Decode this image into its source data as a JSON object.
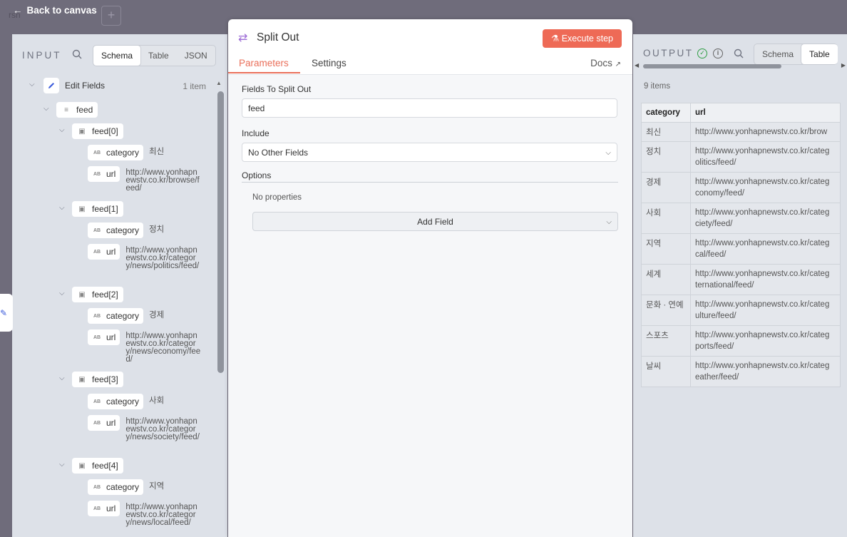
{
  "topbar": {
    "back_label": "Back to canvas",
    "node_ghost": "rsn",
    "plus": "+"
  },
  "input": {
    "title": "INPUT",
    "tabs": [
      "Schema",
      "Table",
      "JSON"
    ],
    "active_tab": "Schema",
    "root": {
      "label": "Edit Fields",
      "count": "1 item"
    },
    "feed_label": "feed",
    "items": [
      {
        "label": "feed[0]",
        "category": "최신",
        "url": "http://www.yonhapnewstv.co.kr/browse/feed/"
      },
      {
        "label": "feed[1]",
        "category": "정치",
        "url": "http://www.yonhapnewstv.co.kr/category/news/politics/feed/"
      },
      {
        "label": "feed[2]",
        "category": "경제",
        "url": "http://www.yonhapnewstv.co.kr/category/news/economy/feed/"
      },
      {
        "label": "feed[3]",
        "category": "사회",
        "url": "http://www.yonhapnewstv.co.kr/category/news/society/feed/"
      },
      {
        "label": "feed[4]",
        "category": "지역",
        "url": "http://www.yonhapnewstv.co.kr/category/news/local/feed/"
      }
    ],
    "key_category": "category",
    "key_url": "url"
  },
  "node": {
    "title": "Split Out",
    "execute_label": "Execute step",
    "tabs": {
      "parameters": "Parameters",
      "settings": "Settings"
    },
    "docs_label": "Docs",
    "fields_to_split_label": "Fields To Split Out",
    "fields_to_split_value": "feed",
    "include_label": "Include",
    "include_value": "No Other Fields",
    "options_label": "Options",
    "no_properties": "No properties",
    "add_field": "Add Field"
  },
  "output": {
    "title": "OUTPUT",
    "tabs": [
      "Schema",
      "Table"
    ],
    "active_tab": "Table",
    "items_count": "9 items",
    "columns": [
      "category",
      "url"
    ],
    "rows": [
      {
        "category": "최신",
        "url1": "http://www.yonhapnewstv.co.kr/brow",
        "url2": ""
      },
      {
        "category": "정치",
        "url1": "http://www.yonhapnewstv.co.kr/categ",
        "url2": "olitics/feed/"
      },
      {
        "category": "경제",
        "url1": "http://www.yonhapnewstv.co.kr/categ",
        "url2": "conomy/feed/"
      },
      {
        "category": "사회",
        "url1": "http://www.yonhapnewstv.co.kr/categ",
        "url2": "ciety/feed/"
      },
      {
        "category": "지역",
        "url1": "http://www.yonhapnewstv.co.kr/categ",
        "url2": "cal/feed/"
      },
      {
        "category": "세계",
        "url1": "http://www.yonhapnewstv.co.kr/categ",
        "url2": "ternational/feed/"
      },
      {
        "category": "문화 · 연예",
        "url1": "http://www.yonhapnewstv.co.kr/categ",
        "url2": "ulture/feed/"
      },
      {
        "category": "스포츠",
        "url1": "http://www.yonhapnewstv.co.kr/categ",
        "url2": "ports/feed/"
      },
      {
        "category": "날씨",
        "url1": "http://www.yonhapnewstv.co.kr/categ",
        "url2": "eather/feed/"
      }
    ]
  },
  "colors": {
    "accent": "#ea6f5a",
    "execute": "#ee6a56",
    "success": "#2f9e44",
    "node_icon": "#9d6cd6"
  }
}
